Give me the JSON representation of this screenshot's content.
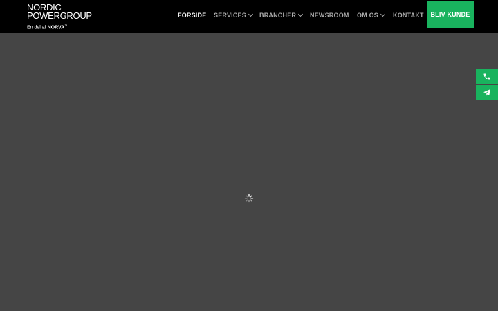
{
  "logo": {
    "line1": "NORDIC",
    "line2": "POWERGROUP",
    "tagline_prefix": "En del af",
    "tagline_brand": "NORVA",
    "tagline_mark": "™"
  },
  "nav": {
    "items": [
      {
        "label": "FORSIDE",
        "active": true,
        "dropdown": false
      },
      {
        "label": "SERVICES",
        "active": false,
        "dropdown": true
      },
      {
        "label": "BRANCHER",
        "active": false,
        "dropdown": true
      },
      {
        "label": "NEWSROOM",
        "active": false,
        "dropdown": false
      },
      {
        "label": "OM OS",
        "active": false,
        "dropdown": true
      },
      {
        "label": "KONTAKT",
        "active": false,
        "dropdown": false
      }
    ],
    "cta_label": "BLIV KUNDE"
  },
  "side_buttons": [
    {
      "icon": "phone-icon"
    },
    {
      "icon": "paper-plane-icon"
    }
  ],
  "colors": {
    "header_bg": "#000000",
    "page_bg": "#454545",
    "accent": "#19b35e",
    "nav_text": "#aaaaaa",
    "nav_active": "#ffffff"
  },
  "loading": true
}
